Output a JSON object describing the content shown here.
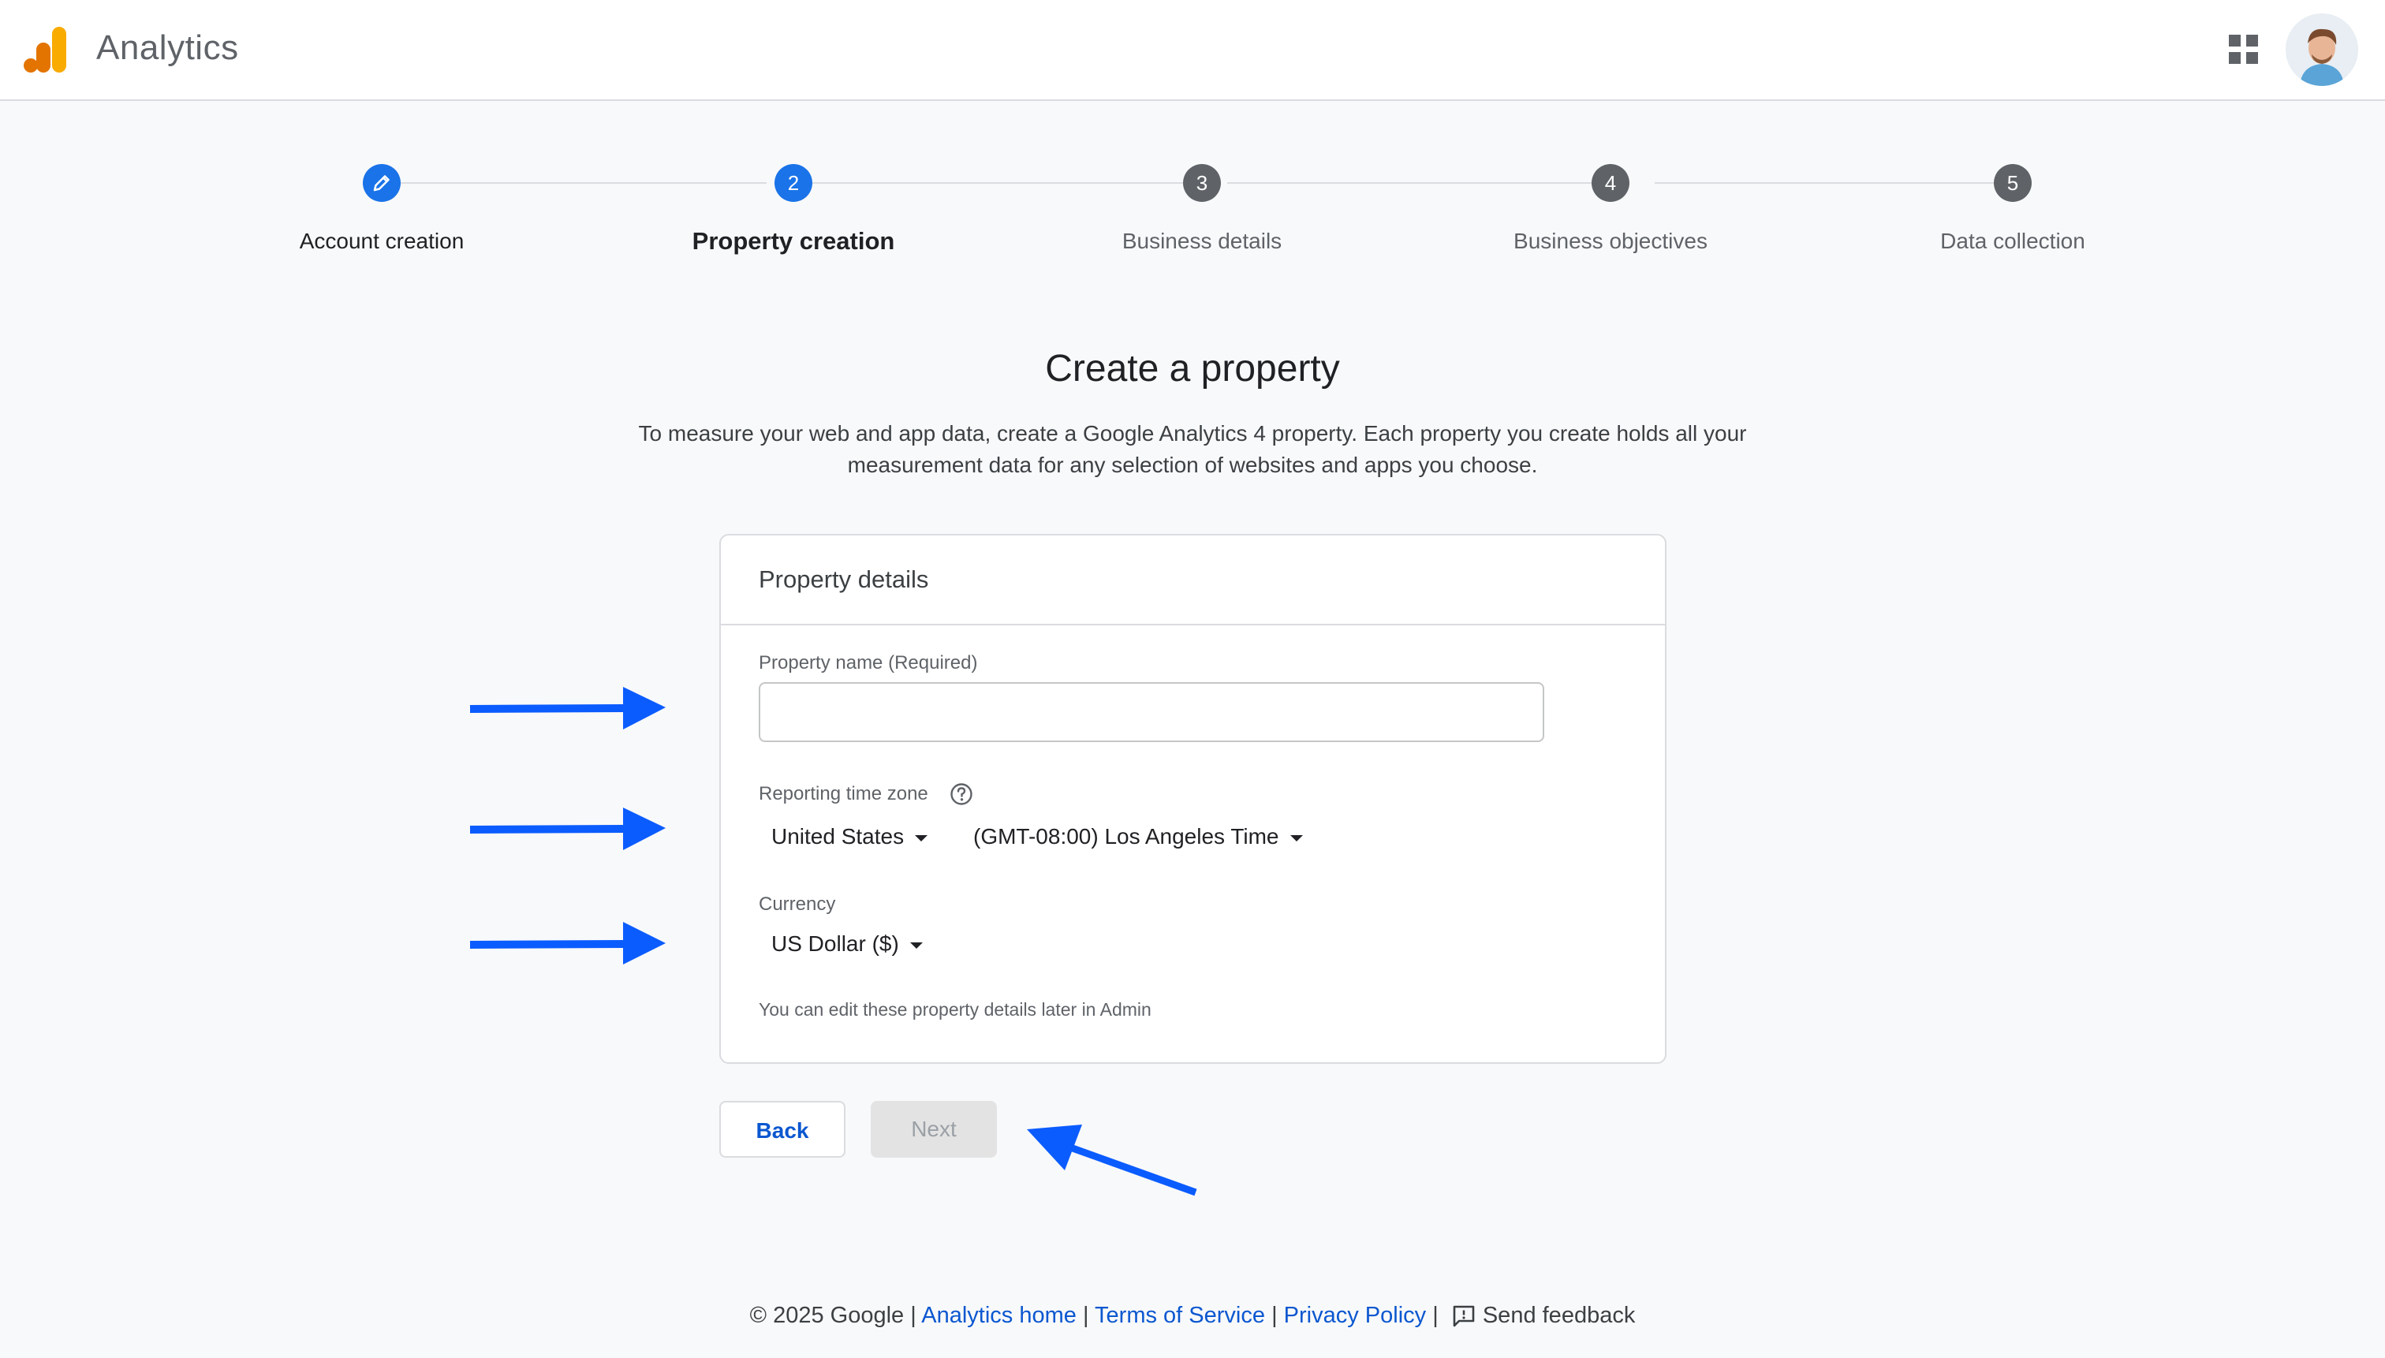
{
  "app": {
    "title": "Analytics"
  },
  "stepper": {
    "steps": [
      {
        "number": "",
        "label": "Account creation",
        "state": "completed"
      },
      {
        "number": "2",
        "label": "Property creation",
        "state": "active"
      },
      {
        "number": "3",
        "label": "Business details",
        "state": "pending"
      },
      {
        "number": "4",
        "label": "Business objectives",
        "state": "pending"
      },
      {
        "number": "5",
        "label": "Data collection",
        "state": "pending"
      }
    ]
  },
  "main": {
    "title": "Create a property",
    "description_line1": "To measure your web and app data, create a Google Analytics 4 property. Each property you create holds all your",
    "description_line2": "measurement data for any selection of websites and apps you choose."
  },
  "card": {
    "title": "Property details",
    "property_name_label": "Property name (Required)",
    "property_name_value": "",
    "timezone_label": "Reporting time zone",
    "country_value": "United States",
    "timezone_value": "(GMT-08:00) Los Angeles Time",
    "currency_label": "Currency",
    "currency_value": "US Dollar ($)",
    "note": "You can edit these property details later in Admin"
  },
  "buttons": {
    "back": "Back",
    "next": "Next"
  },
  "footer": {
    "copyright": "© 2025 Google |",
    "analytics_home": "Analytics home",
    "sep": "|",
    "terms": "Terms of Service",
    "privacy": "Privacy Policy",
    "feedback": "Send feedback"
  },
  "colors": {
    "accent": "#1a73e8",
    "step_pending": "#5f6368",
    "link": "#0b57d0",
    "annotation_arrow": "#0b5cff",
    "logo_orange": "#f9ab00",
    "logo_dark_orange": "#e37400"
  },
  "icons": [
    "analytics-logo-icon",
    "apps-grid-icon",
    "edit-pencil-icon",
    "help-icon",
    "caret-down-icon",
    "feedback-icon",
    "annotation-arrow"
  ]
}
